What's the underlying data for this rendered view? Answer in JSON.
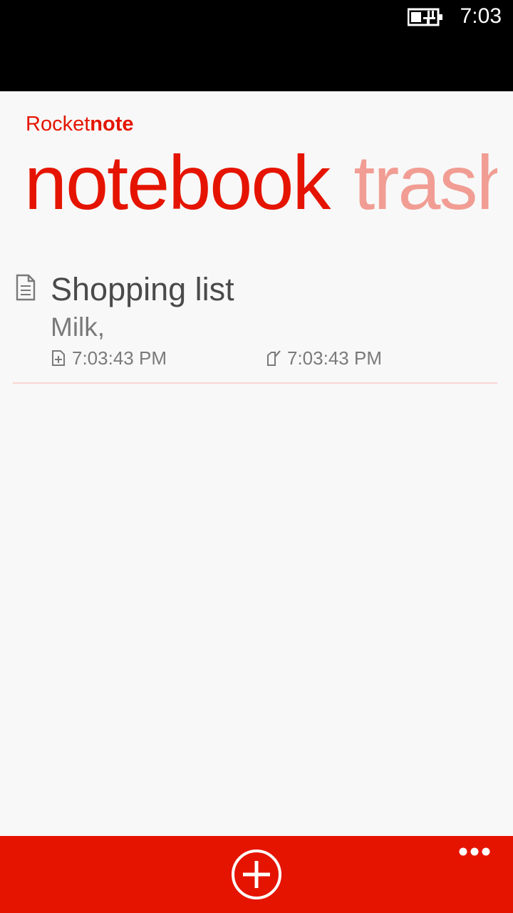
{
  "status_bar": {
    "time": "7:03",
    "battery_icon": "battery-charging-icon"
  },
  "app": {
    "title_regular": "Rocket",
    "title_bold": "note"
  },
  "pivot": {
    "items": [
      {
        "label": "notebook",
        "active": true
      },
      {
        "label": "trash",
        "active": false
      }
    ]
  },
  "notes": [
    {
      "title": "Shopping list",
      "preview": "Milk,",
      "created": "7:03:43 PM",
      "modified": "7:03:43 PM",
      "icon": "note-document-icon"
    }
  ],
  "app_bar": {
    "add_icon": "add-circle-icon",
    "more_icon": "ellipsis-icon"
  },
  "colors": {
    "accent": "#e51400",
    "accent_faded": "#f19d93",
    "text_primary": "#4a4a4a",
    "text_secondary": "#7a7a7a",
    "background": "#f8f8f8",
    "separator": "#f8d6d0"
  }
}
